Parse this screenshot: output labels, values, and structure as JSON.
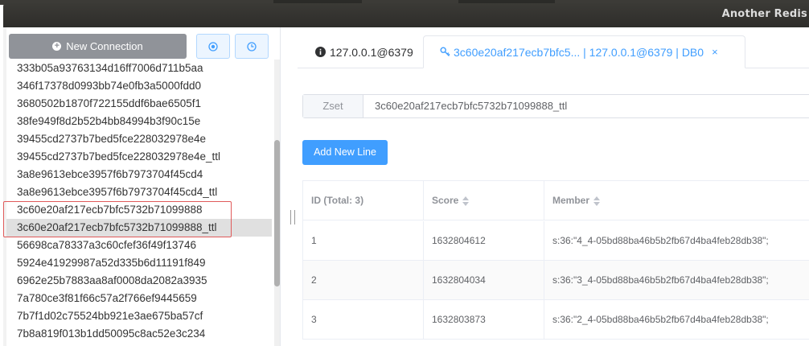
{
  "window": {
    "title": "Another Redis"
  },
  "sidebar": {
    "new_connection_label": "New Connection",
    "keys": [
      "333b05a93763134d16ff7006d711b5aa",
      "346f17378d0993bb74e0fb3a5000fdd0",
      "3680502b1870f722155ddf6bae6505f1",
      "38fe949f8d2b52b4bb84994b3f90c15e",
      "39455cd2737b7bed5fce228032978e4e",
      "39455cd2737b7bed5fce228032978e4e_ttl",
      "3a8e9613ebce3957f6b7973704f45cd4",
      "3a8e9613ebce3957f6b7973704f45cd4_ttl",
      "3c60e20af217ecb7bfc5732b71099888",
      "3c60e20af217ecb7bfc5732b71099888_ttl",
      "56698ca78337a3c60cfef36f49f13746",
      "5924e41929987a52d335b6d11191f849",
      "6962e25b7883aa8af0008da2082a3935",
      "7a780ce3f81f66c57a2f766ef9445659",
      "7b7f1d02c75524bb921e3ae675ba57cf",
      "7b8a819f013b1dd50095c8ac52e3c234"
    ],
    "selected_index": 9
  },
  "tabs": [
    {
      "label": "127.0.0.1@6379",
      "icon": "info-icon"
    },
    {
      "label": "3c60e20af217ecb7bfc5... | 127.0.0.1@6379 | DB0",
      "icon": "key-icon",
      "close": "×"
    }
  ],
  "key_detail": {
    "type": "Zset",
    "name": "3c60e20af217ecb7bfc5732b71099888_ttl",
    "add_button": "Add New Line"
  },
  "table": {
    "headers": {
      "id": "ID (Total: 3)",
      "score": "Score",
      "member": "Member"
    },
    "rows": [
      {
        "id": "1",
        "score": "1632804612",
        "member": "s:36:\"4_4-05bd88ba46b5b2fb67d4ba4feb28db38\";"
      },
      {
        "id": "2",
        "score": "1632804034",
        "member": "s:36:\"3_4-05bd88ba46b5b2fb67d4ba4feb28db38\";"
      },
      {
        "id": "3",
        "score": "1632803873",
        "member": "s:36:\"2_4-05bd88ba46b5b2fb67d4ba4feb28db38\";"
      }
    ]
  },
  "colors": {
    "accent": "#409eff",
    "highlight": "#e05a5a"
  }
}
